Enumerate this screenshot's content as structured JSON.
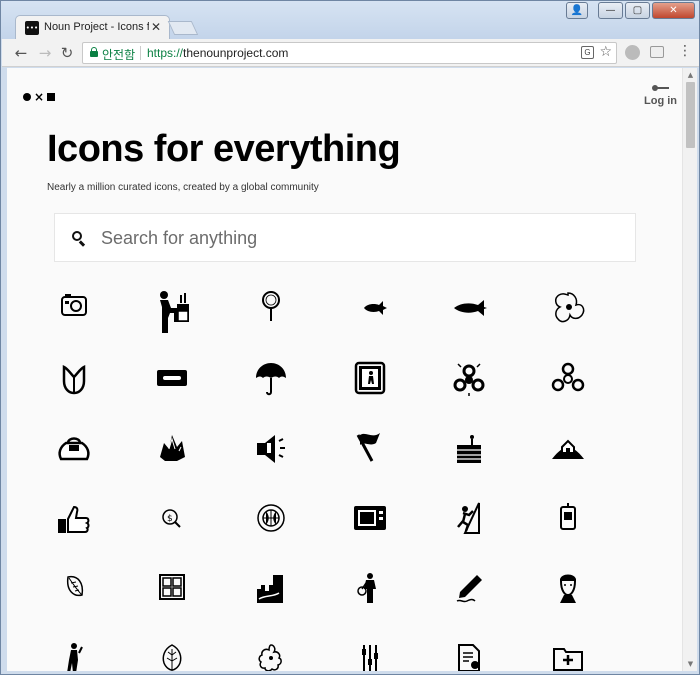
{
  "browser": {
    "tab": {
      "title": "Noun Project - Icons fo",
      "favicon": "noun-project-favicon",
      "close_label": "✕"
    },
    "window_controls": {
      "user": "👤",
      "minimize": "—",
      "maximize": "▢",
      "close": "✕"
    },
    "nav": {
      "back": "←",
      "forward": "→",
      "reload": "↻"
    },
    "address": {
      "secure_label": "안전함",
      "scheme": "https://",
      "host": "thenounproject.com"
    },
    "translate": "G",
    "menu": "⋮"
  },
  "page": {
    "logo": {
      "x_glyph": "×"
    },
    "login": {
      "label": "Log in",
      "icon": "key-icon"
    },
    "headline": "Icons for everything",
    "subhead": "Nearly a million curated icons, created by a global community",
    "search": {
      "placeholder": "Search for anything",
      "value": ""
    },
    "icons": [
      [
        "camera-icon",
        "chef-cooking-icon",
        "magnifying-glass-icon",
        "swordfish-icon",
        "tuna-fish-icon",
        "orchid-flower-icon"
      ],
      [
        "tulip-icon",
        "razor-blade-icon",
        "umbrella-icon",
        "person-in-doorway-icon",
        "fidget-spinner-icon",
        "fidget-spinner-outline-icon"
      ],
      [
        "kettlebell-icon",
        "crystals-icon",
        "loudspeaker-icon",
        "flag-on-pole-icon",
        "cake-slice-icon",
        "house-on-hill-icon"
      ],
      [
        "thumbs-up-icon",
        "money-search-icon",
        "globe-target-icon",
        "microwave-icon",
        "climber-icon",
        "phone-card-icon"
      ],
      [
        "leaf-icon",
        "window-grid-icon",
        "skyline-landscape-icon",
        "woman-with-basket-icon",
        "pen-signature-icon",
        "worker-head-icon"
      ],
      [
        "person-with-cane-icon",
        "leaf-outline-icon",
        "blossom-icon",
        "equalizer-sliders-icon",
        "recipe-document-icon",
        "medical-folder-icon"
      ]
    ]
  }
}
